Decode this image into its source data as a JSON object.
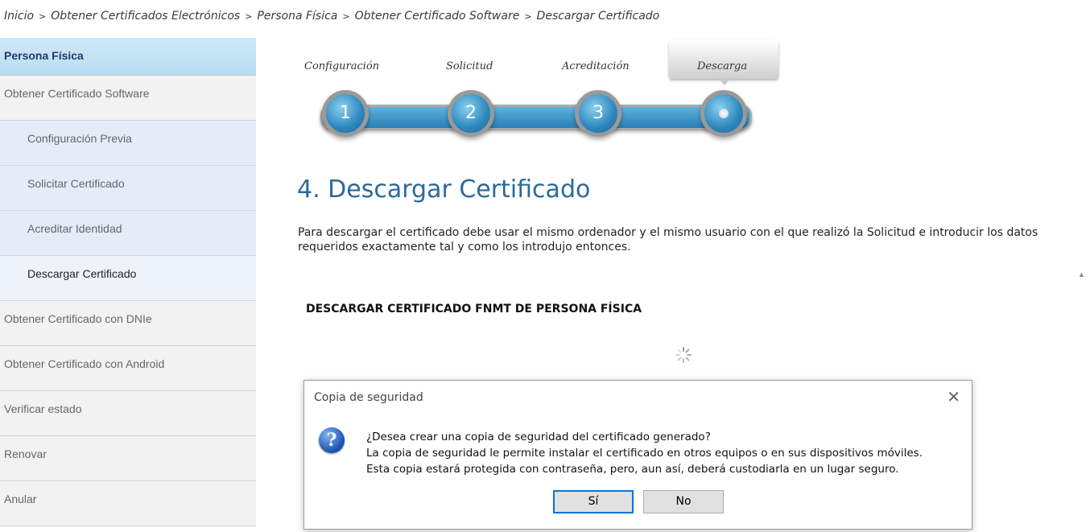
{
  "breadcrumb": {
    "items": [
      "Inicio",
      "Obtener Certificados Electrónicos",
      "Persona Física",
      "Obtener Certificado Software",
      "Descargar Certificado"
    ],
    "separator": ">"
  },
  "sidebar": {
    "header": "Persona Física",
    "items": [
      {
        "label": "Obtener Certificado Software"
      },
      {
        "label": "Configuración Previa"
      },
      {
        "label": "Solicitar Certificado"
      },
      {
        "label": "Acreditar Identidad"
      },
      {
        "label": "Descargar Certificado"
      },
      {
        "label": "Obtener Certificado con DNIe"
      },
      {
        "label": "Obtener Certificado con Android"
      },
      {
        "label": "Verificar estado"
      },
      {
        "label": "Renovar"
      },
      {
        "label": "Anular"
      }
    ]
  },
  "steps": {
    "labels": [
      "Configuración",
      "Solicitud",
      "Acreditación",
      "Descarga"
    ],
    "numbers": [
      "1",
      "2",
      "3"
    ],
    "active": "Descarga"
  },
  "main": {
    "title": "4. Descargar Certificado",
    "description": "Para descargar el certificado debe usar el mismo ordenador y el mismo usuario con el que realizó la Solicitud e introducir los datos requeridos exactamente tal y como los introdujo entonces.",
    "section_heading": "DESCARGAR CERTIFICADO FNMT DE PERSONA FÍSICA"
  },
  "dialog": {
    "title": "Copia de seguridad",
    "close": "✕",
    "icon": "?",
    "lines": [
      "¿Desea crear una copia de seguridad del certificado generado?",
      "La copia de seguridad le permite instalar el certificado en otros equipos o en sus dispositivos móviles.",
      "Esta copia estará protegida con contraseña, pero, aun así, deberá custodiarla en un lugar seguro."
    ],
    "yes": "Sí",
    "no": "No"
  },
  "scroll_arrow": "▲"
}
